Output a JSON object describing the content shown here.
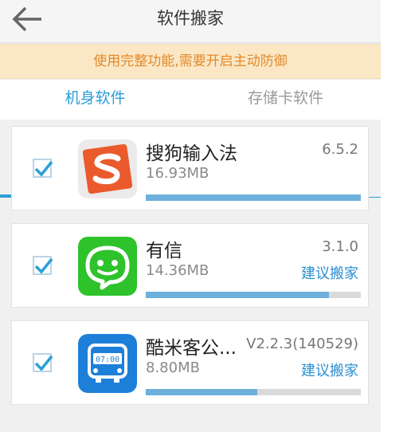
{
  "header": {
    "title": "软件搬家",
    "back_icon": "arrow-left-icon"
  },
  "banner": {
    "text": "使用完整功能,需要开启主动防御",
    "color": "#e08a2c",
    "background": "#fbe7c4"
  },
  "tabs": [
    {
      "label": "机身软件",
      "active": true
    },
    {
      "label": "存储卡软件",
      "active": false
    }
  ],
  "accent_color": "#2a9fd8",
  "apps": [
    {
      "name": "搜狗输入法",
      "version": "6.5.2",
      "size": "16.93MB",
      "suggestion": "",
      "checked": true,
      "progress": 1.0,
      "icon": "sogou-input-icon"
    },
    {
      "name": "有信",
      "version": "3.1.0",
      "size": "14.36MB",
      "suggestion": "建议搬家",
      "checked": true,
      "progress": 0.85,
      "icon": "youxin-icon"
    },
    {
      "name": "酷米客公...",
      "version": "V2.2.3(140529)",
      "size": "8.80MB",
      "suggestion": "建议搬家",
      "checked": true,
      "progress": 0.52,
      "icon": "bus-icon"
    }
  ]
}
